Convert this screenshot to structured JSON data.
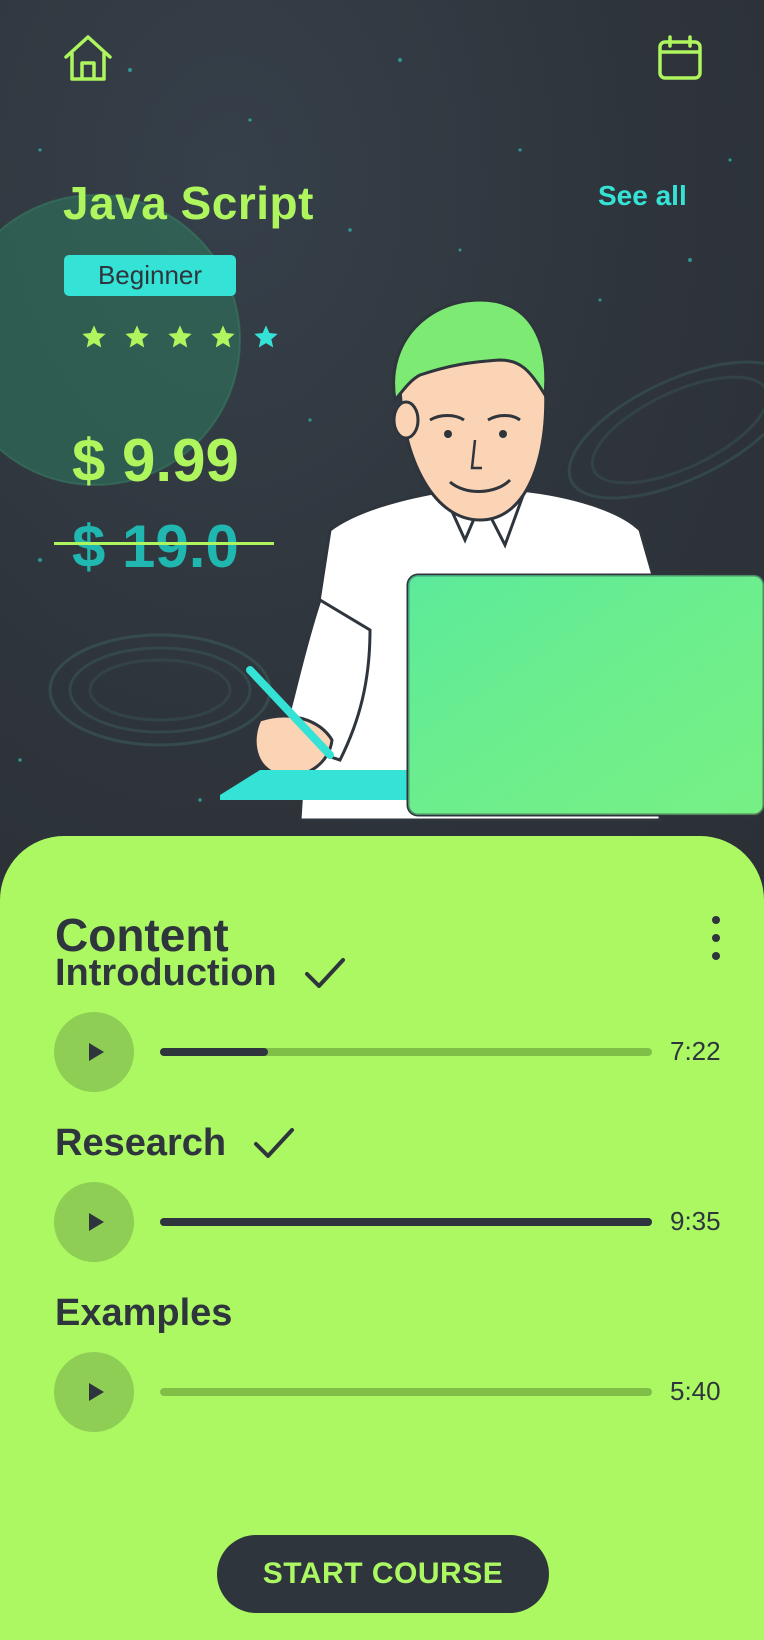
{
  "header": {
    "home_icon": "home-icon",
    "calendar_icon": "calendar-icon"
  },
  "course": {
    "title": "Java Script",
    "see_all": "See all",
    "level": "Beginner",
    "rating": {
      "value": 5,
      "max": 5
    },
    "price": "$ 9.99",
    "old_price": "$ 19.0"
  },
  "content": {
    "heading": "Content",
    "lessons": [
      {
        "title": "Introduction",
        "completed": true,
        "progress": 0.22,
        "duration": "7:22"
      },
      {
        "title": "Research",
        "completed": true,
        "progress": 1.0,
        "duration": "9:35"
      },
      {
        "title": "Examples",
        "completed": false,
        "progress": 0.0,
        "duration": "5:40"
      }
    ],
    "cta": "START COURSE"
  },
  "colors": {
    "accent_green": "#abf863",
    "accent_teal": "#35e2d6",
    "dark": "#2f353c"
  }
}
